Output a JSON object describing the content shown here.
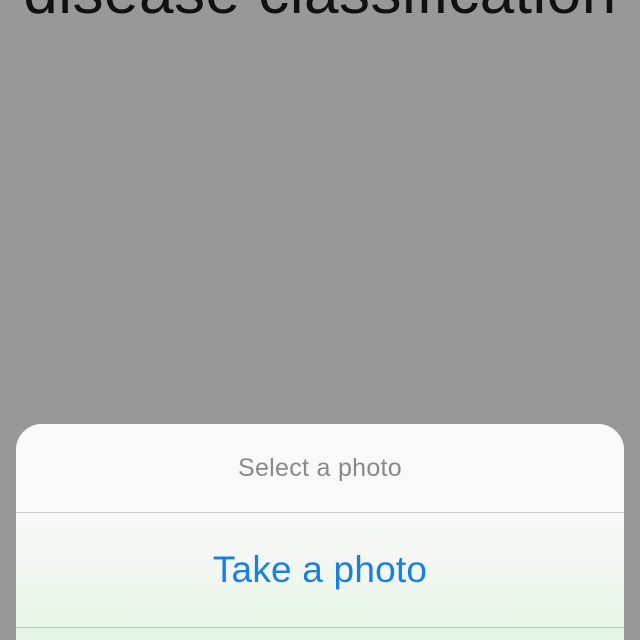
{
  "background": {
    "title_fragment": "disease classification",
    "dim_color": "#989898"
  },
  "action_sheet": {
    "title": "Select a photo",
    "actions": [
      {
        "label": "Take a photo",
        "color": "#1a7fe3"
      }
    ]
  }
}
